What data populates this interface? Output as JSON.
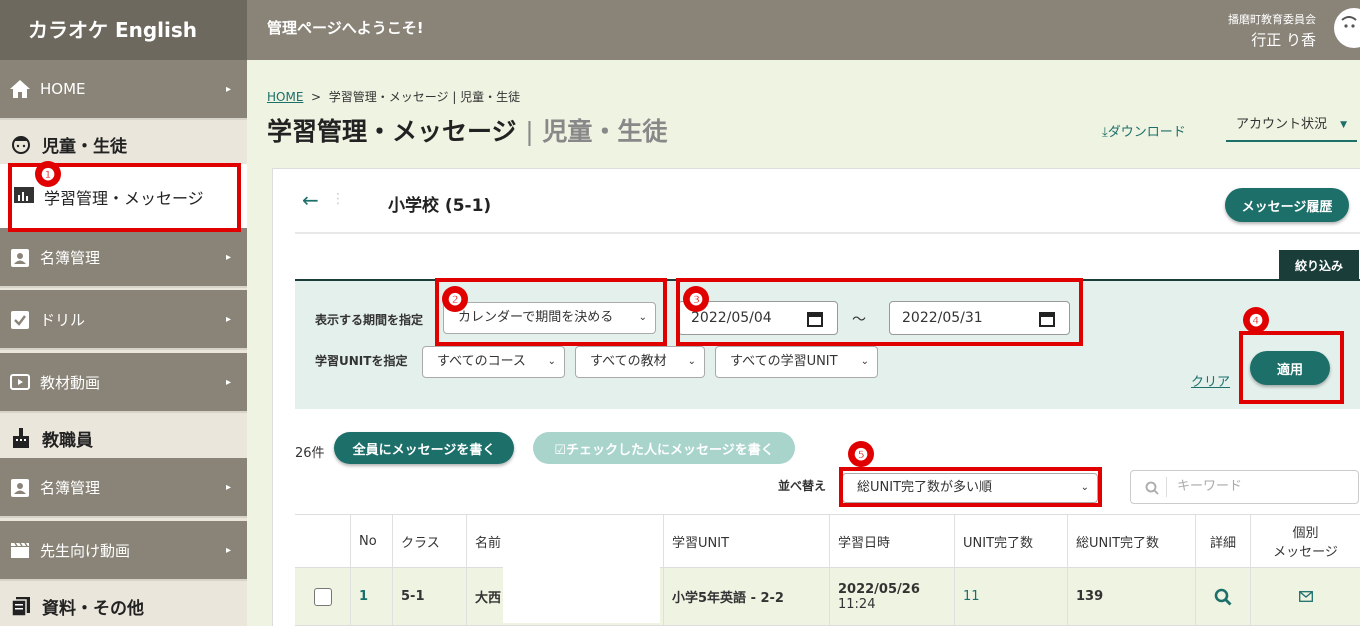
{
  "app": {
    "logo": "カラオケ English",
    "welcome": "管理ページへようこそ!",
    "org": "播磨町教育委員会",
    "user": "行正 り香"
  },
  "sidebar": {
    "home": "HOME",
    "students_head": "児童・生徒",
    "learning": "学習管理・メッセージ",
    "roster": "名簿管理",
    "drill": "ドリル",
    "videos": "教材動画",
    "staff_head": "教職員",
    "staff_roster": "名簿管理",
    "teacher_videos": "先生向け動画",
    "materials_head": "資料・その他"
  },
  "breadcrumb": {
    "home": "HOME",
    "sep": ">",
    "current": "学習管理・メッセージ | 児童・生徒"
  },
  "page": {
    "title": "学習管理・メッセージ",
    "title_sep": "|",
    "title_sub": "児童・生徒",
    "download": "ダウンロード",
    "account": "アカウント状況"
  },
  "card": {
    "back": "←",
    "school": "小学校 (5-1)",
    "history_button": "メッセージ履歴"
  },
  "filter": {
    "tab": "絞り込み",
    "period_label": "表示する期間を指定",
    "period_select": "カレンダーで期間を決める",
    "date_from": "2022/05/04",
    "tilde": "～",
    "date_to": "2022/05/31",
    "unit_label": "学習UNITを指定",
    "course": "すべてのコース",
    "material": "すべての教材",
    "unit": "すべての学習UNIT",
    "clear": "クリア",
    "apply": "適用"
  },
  "list": {
    "count": "26件",
    "msg_all": "全員にメッセージを書く",
    "msg_checked": "☑チェックした人にメッセージを書く",
    "sort_label": "並べ替え",
    "sort_value": "総UNIT完了数が多い順",
    "search_placeholder": "キーワード"
  },
  "table": {
    "headers": {
      "no": "No",
      "class": "クラス",
      "name": "名前",
      "unit": "学習UNIT",
      "datetime": "学習日時",
      "unit_done": "UNIT完了数",
      "total_done": "総UNIT完了数",
      "detail": "詳細",
      "message_1": "個別",
      "message_2": "メッセージ"
    },
    "rows": [
      {
        "no": "1",
        "class": "5-1",
        "name": "大西",
        "unit": "小学5年英語 - 2-2",
        "date": "2022/05/26",
        "time": "11:24",
        "unit_done": "11",
        "total_done": "139"
      }
    ]
  },
  "annotations": [
    "❶",
    "❷",
    "❸",
    "❹",
    "❺"
  ],
  "colors": {
    "accent": "#1d6f6a",
    "annotation": "#e00000",
    "sidebar": "#8a8478"
  }
}
